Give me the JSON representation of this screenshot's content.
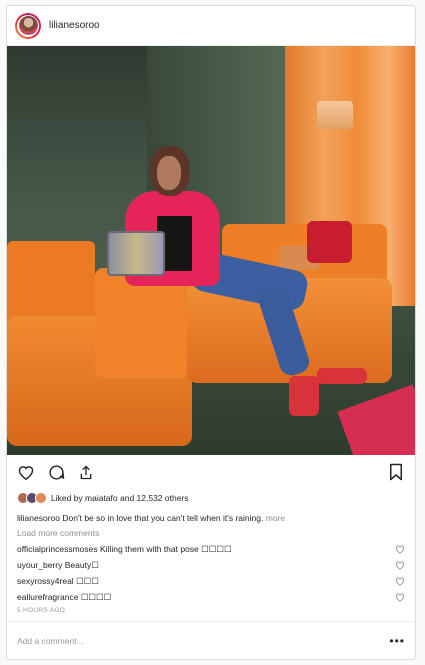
{
  "post": {
    "username": "lilianesoroo",
    "likes_text": "Liked by maiatafo and 12,532 others",
    "caption_user": "lilianesoroo",
    "caption_text": "Don't be so in love that you can't tell when it's raining.",
    "caption_more": "more",
    "load_more": "Load more comments",
    "comments": [
      {
        "user": "officialprincessmoses",
        "text": "Killing them with that pose ☐☐☐☐"
      },
      {
        "user": "uyour_berry",
        "text": "Beauty☐"
      },
      {
        "user": "sexyrossy4real",
        "text": "☐☐☐"
      },
      {
        "user": "eallurefragrance",
        "text": "☐☐☐☐"
      }
    ],
    "time": "5 HOURS AGO",
    "add_comment_placeholder": "Add a comment...",
    "options": "•••"
  },
  "icons": [
    "heart-icon",
    "comment-icon",
    "share-icon",
    "bookmark-icon",
    "more-options-icon"
  ]
}
